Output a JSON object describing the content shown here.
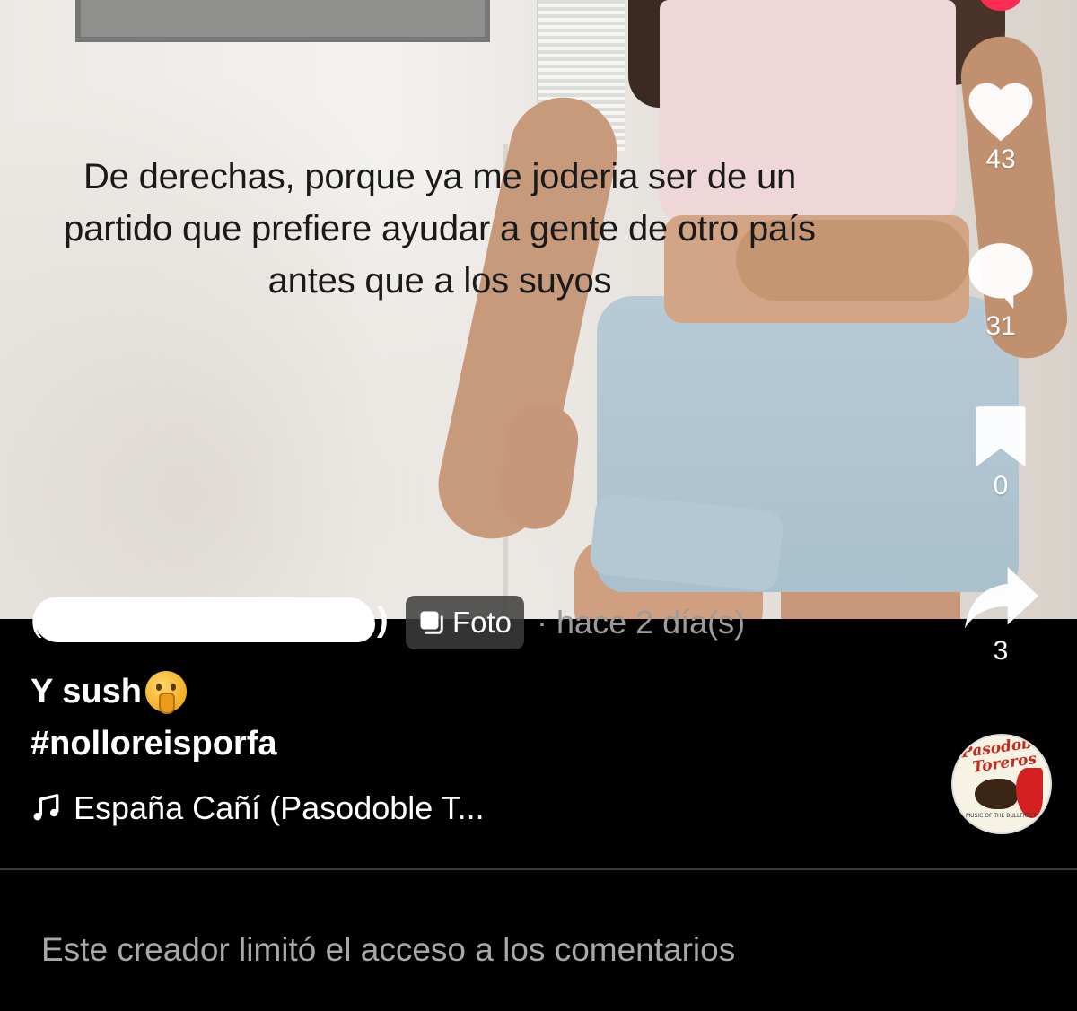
{
  "media": {
    "overlay_caption": "De derechas, porque ya me joderia ser de un partido que prefiere ayudar a gente de otro país antes que a los suyos"
  },
  "actions": {
    "like": {
      "icon": "heart-icon",
      "count": "43"
    },
    "comment": {
      "icon": "comment-bubble-icon",
      "count": "31"
    },
    "save": {
      "icon": "bookmark-icon",
      "count": "0"
    },
    "share": {
      "icon": "share-arrow-icon",
      "count": "3"
    }
  },
  "post": {
    "username_redacted": true,
    "paren_open": "(",
    "paren_close": ")",
    "type_badge": "Foto",
    "time_ago": "· hace 2 día(s)",
    "caption": "Y sush",
    "hashtag": "#nolloreisporfa",
    "music": "España Cañí (Pasodoble T...",
    "sound_disc": {
      "title": "Pasodobles Toreros",
      "subtitle": "MUSIC OF THE BULLFIGHT"
    }
  },
  "comments": {
    "restricted_note": "Este creador limitó el acceso a los comentarios"
  },
  "colors": {
    "background": "#000000",
    "accent_red": "#fe2c55",
    "muted_text": "#9c9c9c"
  }
}
